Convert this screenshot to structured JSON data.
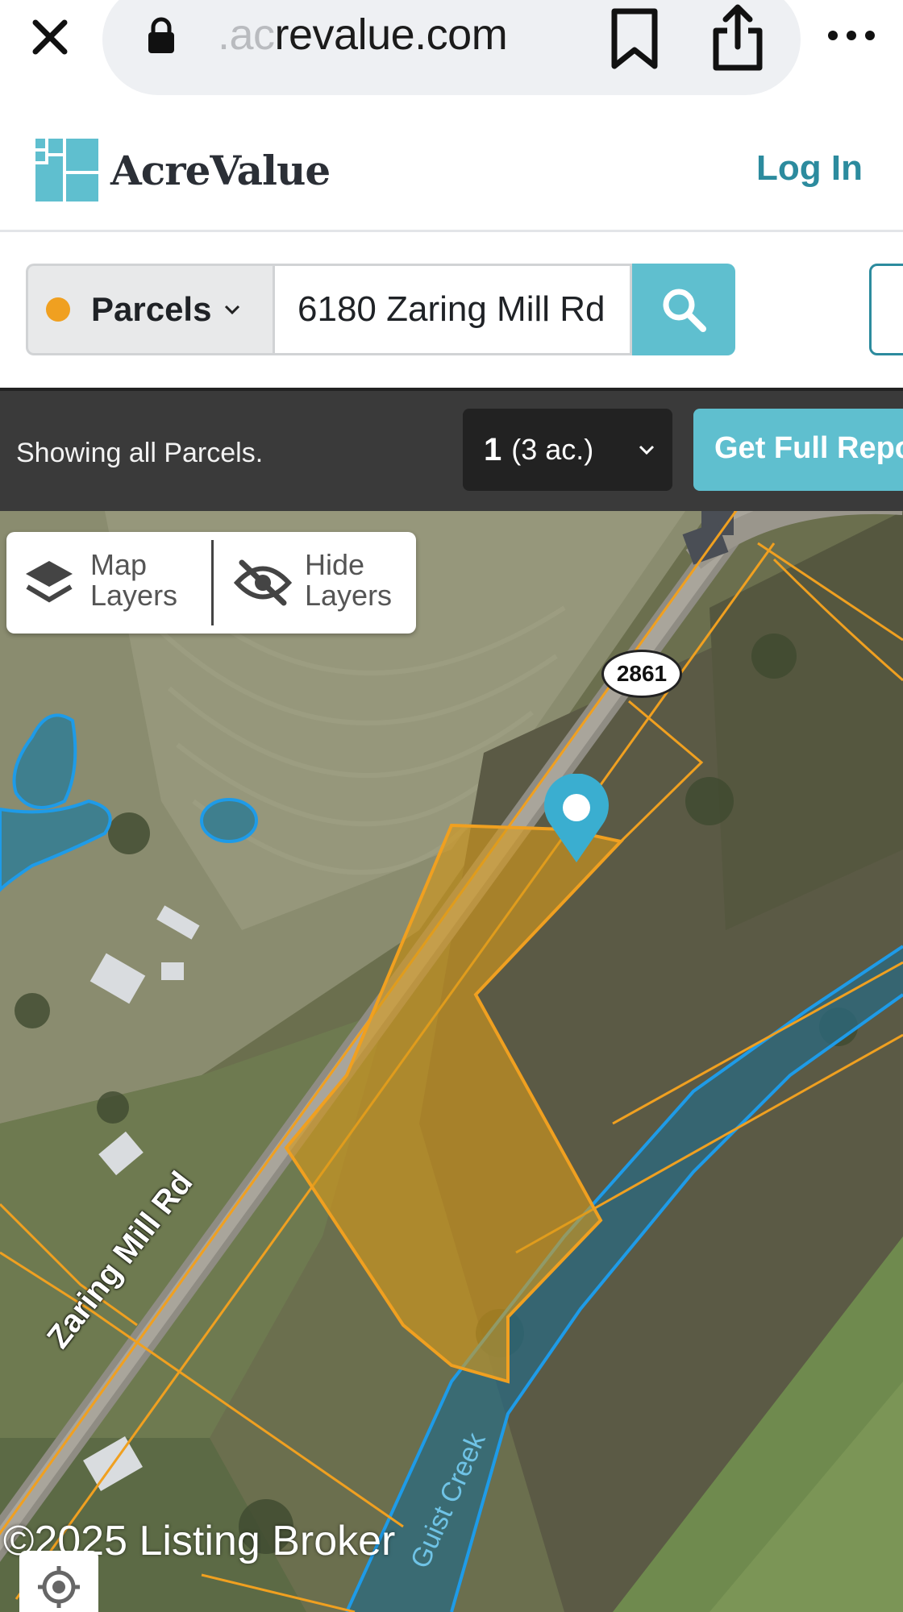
{
  "browser": {
    "url_faded": ".ac",
    "url_main": "revalue.com"
  },
  "header": {
    "logo_text": "AcreValue",
    "login_label": "Log In"
  },
  "search": {
    "layer_select": "Parcels",
    "query_value": "6180 Zaring Mill Rd",
    "accent_color": "#5fbfcf",
    "dot_color": "#f0a020"
  },
  "results": {
    "status_text": "Showing all Parcels.",
    "count": "1",
    "acres": "(3 ac.)",
    "report_button": "Get Full Report"
  },
  "map": {
    "map_layers_label_1": "Map",
    "map_layers_label_2": "Layers",
    "hide_layers_label_1": "Hide",
    "hide_layers_label_2": "Layers",
    "route_badge": "2861",
    "road_name": "Zaring Mill Rd",
    "creek_name": "Guist Creek",
    "copyright": "©2025 Listing Broker",
    "parcel_outline_color": "#f0a020",
    "water_outline_color": "#1e9be8"
  }
}
